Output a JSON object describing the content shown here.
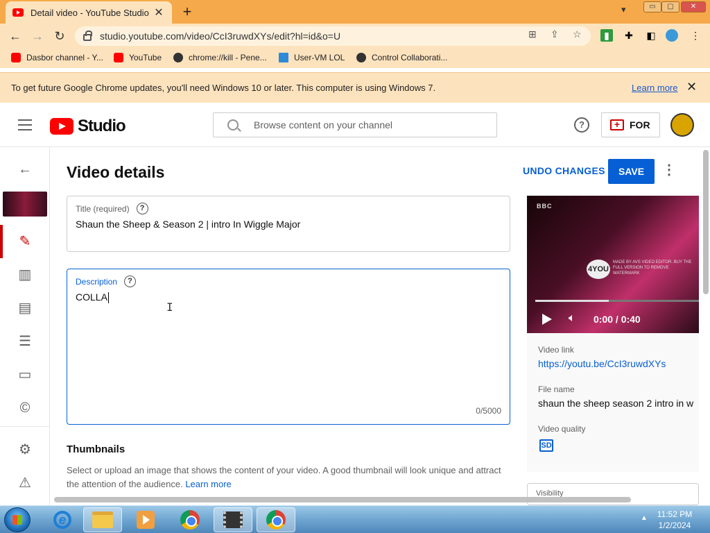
{
  "browser": {
    "tab_title": "Detail video - YouTube Studio",
    "new_tab": "+",
    "tab_close": "✕",
    "url": "studio.youtube.com/video/CcI3ruwdXYs/edit?hl=id&o=U",
    "window_controls": [
      "▭",
      "▢",
      "✕"
    ],
    "bookmarks": [
      {
        "label": "Dasbor channel - Y...",
        "icon": "youtube-icon"
      },
      {
        "label": "YouTube",
        "icon": "youtube-icon"
      },
      {
        "label": "chrome://kill - Pene...",
        "icon": "chrome-icon"
      },
      {
        "label": "User-VM LOL",
        "icon": "monitor-icon"
      },
      {
        "label": "Control Collaborati...",
        "icon": "chrome-icon"
      }
    ],
    "infobar": {
      "text": "To get future Google Chrome updates, you'll need Windows 10 or later. This computer is using Windows 7.",
      "link": "Learn more",
      "close": "✕"
    }
  },
  "studio": {
    "logo_text": "Studio",
    "search_placeholder": "Browse content on your channel",
    "help": "?",
    "create_label": "FOR",
    "create_icon": "+"
  },
  "page": {
    "title": "Video details",
    "undo_label": "UNDO CHANGES",
    "save_label": "SAVE",
    "more": "⋮",
    "title_field": {
      "label": "Title (required)",
      "value": "Shaun the Sheep & Season 2 | intro In Wiggle Major"
    },
    "description_field": {
      "label": "Description",
      "value": "COLLA",
      "counter": "0/5000"
    },
    "thumbnails": {
      "title": "Thumbnails",
      "desc": "Select or upload an image that shows the content of your video. A good thumbnail will look unique and attract the attention of the audience.",
      "link": "Learn more"
    }
  },
  "preview": {
    "bbc": "BBC",
    "channel": "4YOU",
    "watermark": "MADE BY AVS VIDEO EDITOR. BUY THE FULL VERSION TO REMOVE WATERMARK",
    "progress": 0.45,
    "time": "0:00 / 0:40",
    "video_link_label": "Video link",
    "video_link": "https://youtu.be/CcI3ruwdXYs",
    "file_name_label": "File name",
    "file_name": "shaun the sheep season 2 intro in w",
    "quality_label": "Video quality",
    "quality_badge": "SD",
    "visibility_label": "Visibility"
  },
  "taskbar": {
    "time": "11:52 PM",
    "date": "1/2/2024",
    "apps": [
      "internet-explorer-icon",
      "file-explorer-icon",
      "media-player-icon",
      "chrome-icon",
      "movie-maker-icon",
      "chrome-icon"
    ]
  }
}
